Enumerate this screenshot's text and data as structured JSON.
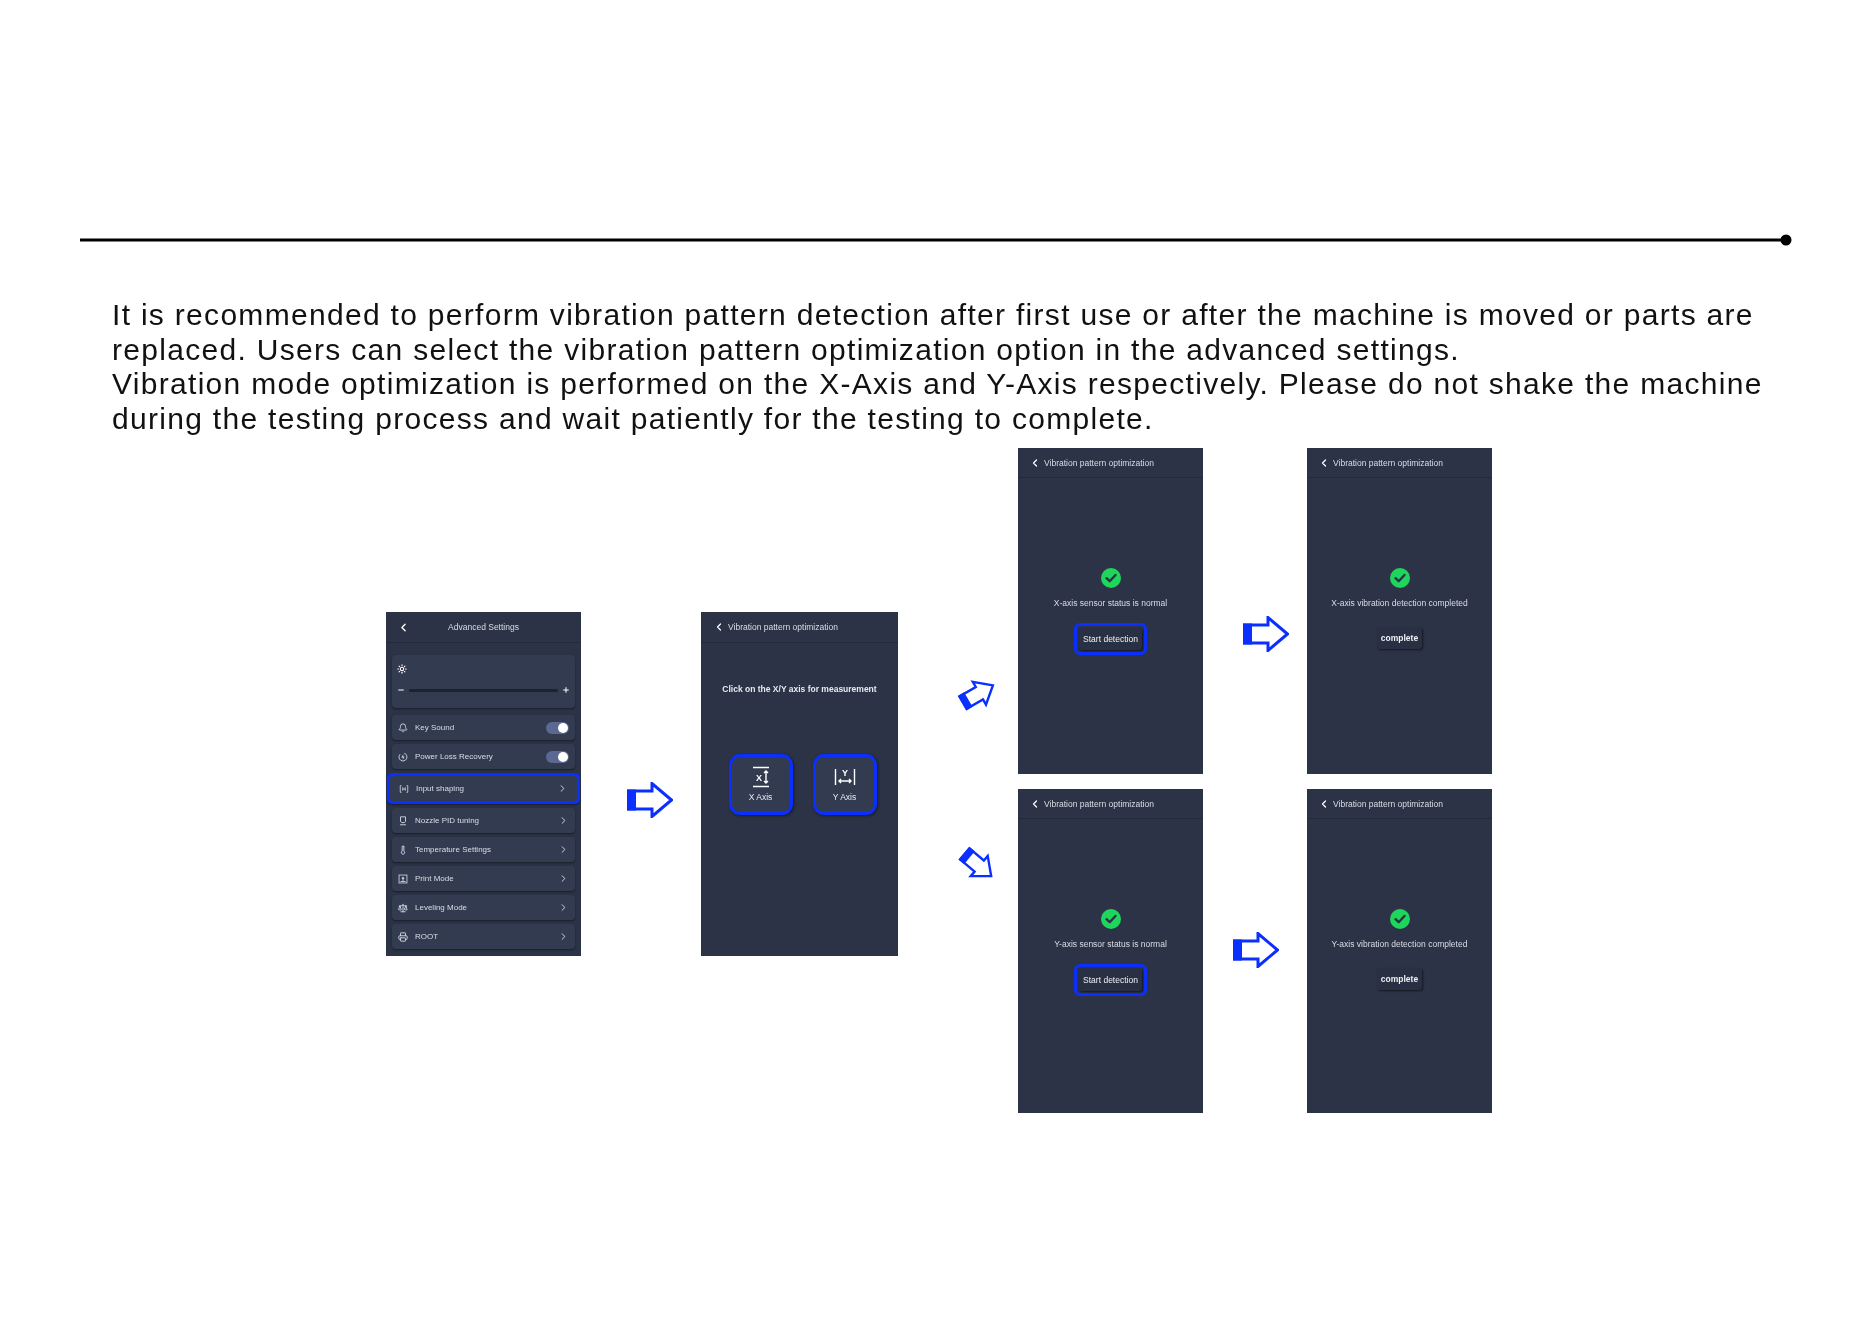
{
  "instructions": [
    "It is recommended to perform vibration pattern detection after first use or after the machine is moved or parts are replaced. Users can select the vibration pattern optimization option in the advanced settings.",
    "Vibration mode optimization is performed on the X-Axis and Y-Axis respectively. Please do not shake the machine during the testing process and wait patiently for the testing to complete."
  ],
  "advanced_settings_screen": {
    "title": "Advanced Settings",
    "items": [
      {
        "kind": "toggle",
        "label": "Key Sound",
        "on": true,
        "highlighted": false
      },
      {
        "kind": "toggle",
        "label": "Power Loss Recovery",
        "on": true,
        "highlighted": false
      },
      {
        "kind": "link",
        "label": "Input shaping",
        "highlighted": true
      },
      {
        "kind": "link",
        "label": "Nozzle PID tuning",
        "highlighted": false
      },
      {
        "kind": "link",
        "label": "Temperature Settings",
        "highlighted": false
      },
      {
        "kind": "link",
        "label": "Print Mode",
        "highlighted": false
      },
      {
        "kind": "link",
        "label": "Leveling Mode",
        "highlighted": false
      },
      {
        "kind": "link",
        "label": "ROOT",
        "highlighted": false
      }
    ]
  },
  "axis_select_screen": {
    "title": "Vibration pattern optimization",
    "prompt": "Click on the X/Y axis for measurement",
    "buttons": [
      {
        "kind": "x",
        "icon_letter": "X",
        "label": "X Axis",
        "highlighted": true
      },
      {
        "kind": "y",
        "icon_letter": "Y",
        "label": "Y Axis",
        "highlighted": true
      }
    ]
  },
  "result_screens": [
    {
      "title": "Vibration pattern optimization",
      "status": "X-axis sensor status is normal",
      "button": {
        "label": "Start detection",
        "highlighted": true
      }
    },
    {
      "title": "Vibration pattern optimization",
      "status": "X-axis vibration detection completed",
      "button": {
        "label": "complete",
        "highlighted": false
      }
    },
    {
      "title": "Vibration pattern optimization",
      "status": "Y-axis sensor status is normal",
      "button": {
        "label": "Start detection",
        "highlighted": true
      }
    },
    {
      "title": "Vibration pattern optimization",
      "status": "Y-axis vibration detection completed",
      "button": {
        "label": "complete",
        "highlighted": false
      }
    }
  ]
}
